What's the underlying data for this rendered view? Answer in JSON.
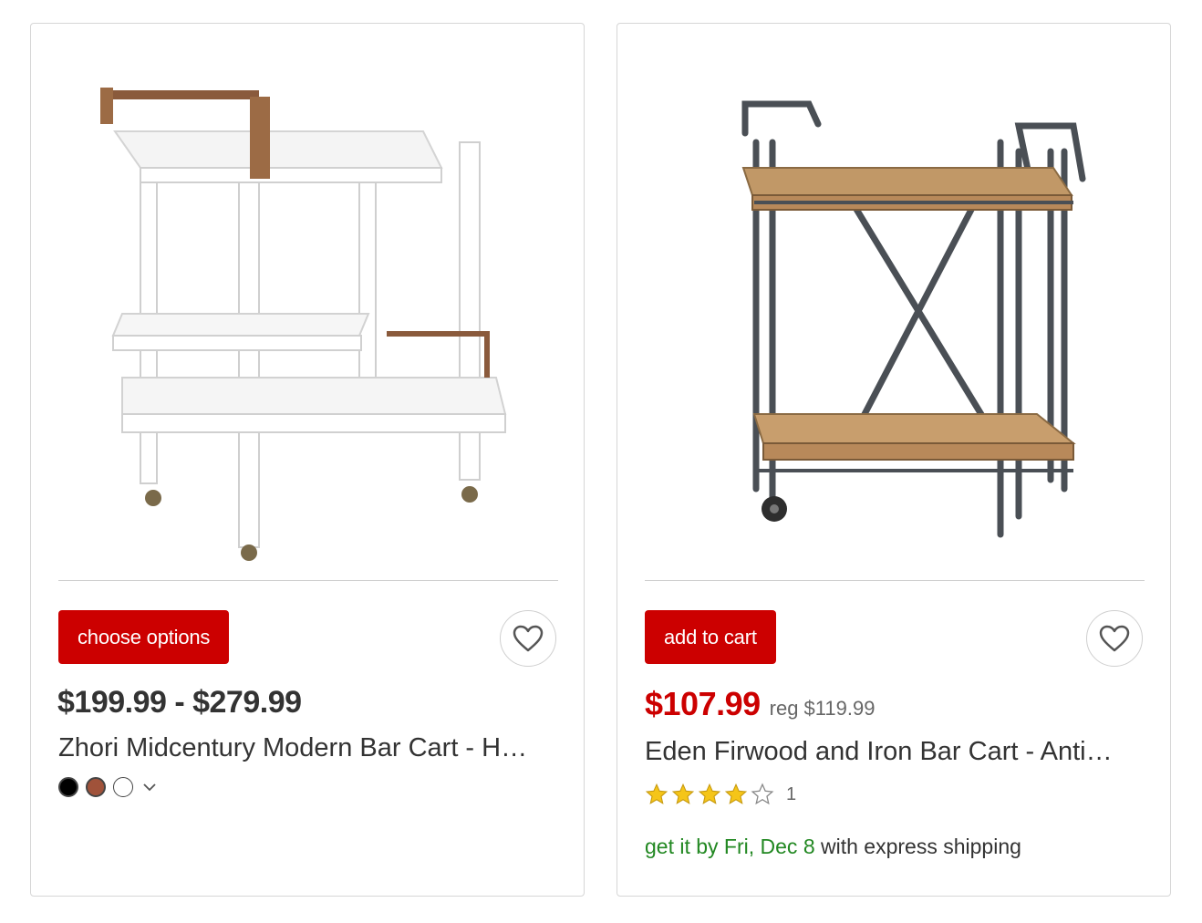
{
  "colors": {
    "accent": "#cc0000",
    "shipping_green": "#228822",
    "star_fill": "#f5c518"
  },
  "products": [
    {
      "button_label": "choose options",
      "price": "$199.99 - $279.99",
      "title": "Zhori Midcentury Modern Bar Cart - H…",
      "swatches": [
        "black",
        "brown",
        "white"
      ],
      "swatch_colors": [
        "#000000",
        "#a0523a",
        "#ffffff"
      ],
      "more_options_icon": "chevron-down-icon",
      "favorite_icon": "heart-icon"
    },
    {
      "button_label": "add to cart",
      "sale_price": "$107.99",
      "reg_price": "reg $119.99",
      "title": "Eden Firwood and Iron Bar Cart - Anti…",
      "rating": 4,
      "rating_max": 5,
      "review_count": "1",
      "shipping_prefix": "get it by Fri, Dec 8",
      "shipping_suffix": " with express shipping",
      "favorite_icon": "heart-icon"
    }
  ]
}
